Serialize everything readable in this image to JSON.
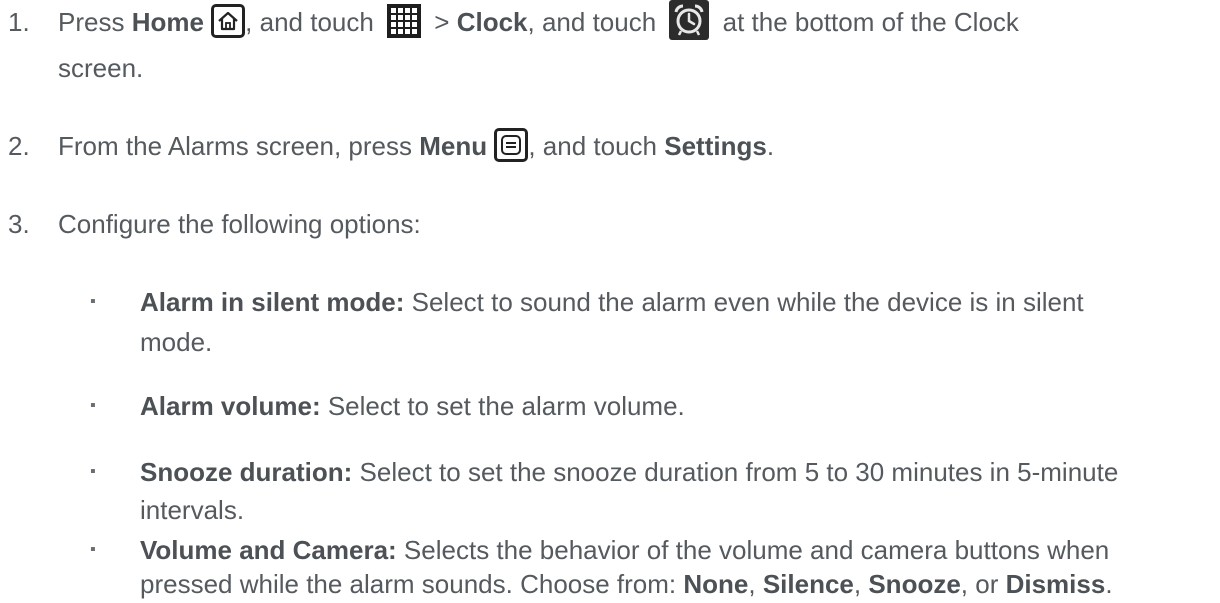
{
  "steps": [
    {
      "number": "1.",
      "press": "Press ",
      "home": "Home",
      "and_touch": ", and touch ",
      "gt": " > ",
      "clock": "Clock",
      "and_touch2": ", and touch ",
      "tail": " at the bottom of the Clock",
      "tail2": "screen."
    },
    {
      "number": "2.",
      "from": "From the Alarms screen, press ",
      "menu": "Menu",
      "and_touch": ", and touch ",
      "settings": "Settings",
      "period": "."
    },
    {
      "number": "3.",
      "text": "Configure the following options:"
    }
  ],
  "options": [
    {
      "bullet": "▪",
      "term": "Alarm in silent mode:",
      "line1": " Select to sound the alarm even while the device is in silent",
      "line2": "mode."
    },
    {
      "bullet": "▪",
      "term": "Alarm volume:",
      "line1": " Select to set the alarm volume."
    },
    {
      "bullet": "▪",
      "term": "Snooze duration:",
      "line1": " Select to set the snooze duration from 5 to 30 minutes in 5-minute",
      "line2": "intervals."
    },
    {
      "bullet": "▪",
      "term": "Volume and Camera:",
      "line1": " Selects the behavior of the volume and camera buttons when",
      "line2_a": "pressed while the alarm sounds. Choose from: ",
      "none": "None",
      "c1": ", ",
      "silence": "Silence",
      "c2": ", ",
      "snooze": "Snooze",
      "c3": ", or ",
      "dismiss": "Dismiss",
      "end": "."
    }
  ],
  "icons": {
    "home": "home-key-icon",
    "apps": "apps-grid-icon",
    "alarm": "alarm-clock-icon",
    "menu": "menu-key-icon"
  }
}
